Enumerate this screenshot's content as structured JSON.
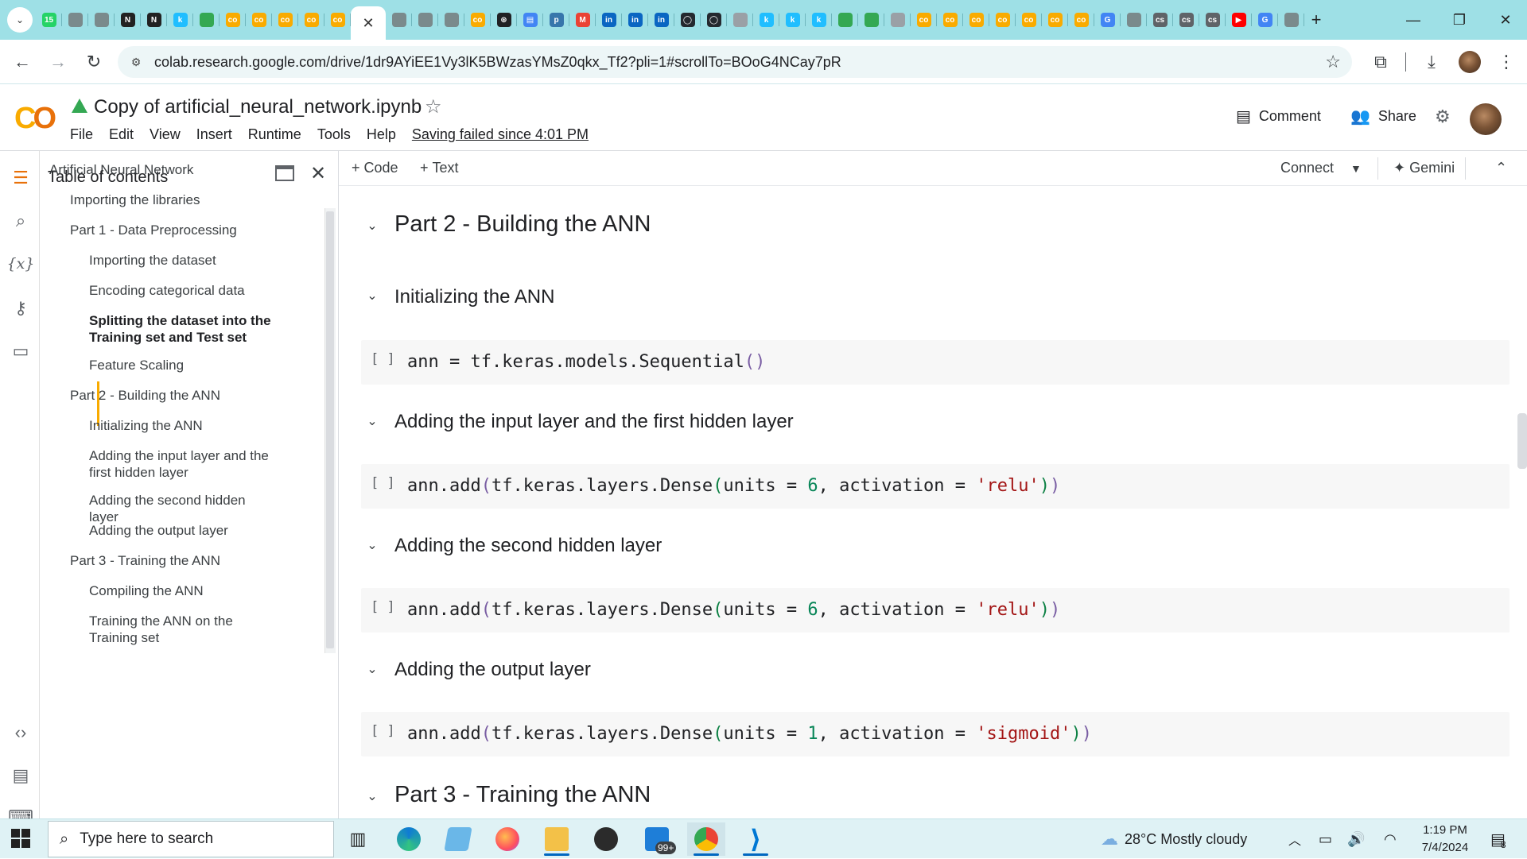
{
  "browser": {
    "tab_favicons": [
      {
        "name": "whatsapp-tab",
        "color": "#25d366",
        "label": "15"
      },
      {
        "name": "globe-tab",
        "color": "#7a8a8c",
        "label": ""
      },
      {
        "name": "globe-tab",
        "color": "#7a8a8c",
        "label": ""
      },
      {
        "name": "notion-tab",
        "color": "#222222",
        "label": "N"
      },
      {
        "name": "notion-tab",
        "color": "#222222",
        "label": "N"
      },
      {
        "name": "kaggle-tab",
        "color": "#20beff",
        "label": "k"
      },
      {
        "name": "drive-tab",
        "color": "#34a853",
        "label": ""
      },
      {
        "name": "colab-tab",
        "color": "#f9ab00",
        "label": "co"
      },
      {
        "name": "colab-tab",
        "color": "#f9ab00",
        "label": "co"
      },
      {
        "name": "colab-tab",
        "color": "#f9ab00",
        "label": "co"
      },
      {
        "name": "colab-tab",
        "color": "#f9ab00",
        "label": "co"
      },
      {
        "name": "colab-tab",
        "color": "#f9ab00",
        "label": "co"
      }
    ],
    "active_tab_close": "✕",
    "tab_favicons_after": [
      {
        "name": "globe-tab",
        "color": "#7a8a8c",
        "label": ""
      },
      {
        "name": "globe-tab",
        "color": "#7a8a8c",
        "label": ""
      },
      {
        "name": "globe-tab",
        "color": "#7a8a8c",
        "label": ""
      },
      {
        "name": "colab-tab",
        "color": "#f9ab00",
        "label": "co"
      },
      {
        "name": "chatgpt-tab",
        "color": "#202124",
        "label": "⊛"
      },
      {
        "name": "docs-tab",
        "color": "#4285f4",
        "label": "▤"
      },
      {
        "name": "python-tab",
        "color": "#3776ab",
        "label": "p"
      },
      {
        "name": "gmail-tab",
        "color": "#ea4335",
        "label": "M"
      },
      {
        "name": "linkedin-tab",
        "color": "#0a66c2",
        "label": "in"
      },
      {
        "name": "linkedin-tab",
        "color": "#0a66c2",
        "label": "in"
      },
      {
        "name": "linkedin-tab",
        "color": "#0a66c2",
        "label": "in"
      },
      {
        "name": "github-tab",
        "color": "#24292f",
        "label": "◯"
      },
      {
        "name": "github-tab",
        "color": "#24292f",
        "label": "◯"
      },
      {
        "name": "globe-tab",
        "color": "#9aa0a6",
        "label": ""
      },
      {
        "name": "kaggle-tab",
        "color": "#20beff",
        "label": "k"
      },
      {
        "name": "kaggle-tab",
        "color": "#20beff",
        "label": "k"
      },
      {
        "name": "kaggle-tab",
        "color": "#20beff",
        "label": "k"
      },
      {
        "name": "drive-tab",
        "color": "#34a853",
        "label": ""
      },
      {
        "name": "drive-tab",
        "color": "#34a853",
        "label": ""
      },
      {
        "name": "drive-tab",
        "color": "#9aa0a6",
        "label": ""
      },
      {
        "name": "colab-tab",
        "color": "#f9ab00",
        "label": "co"
      },
      {
        "name": "colab-tab",
        "color": "#f9ab00",
        "label": "co"
      },
      {
        "name": "colab-tab",
        "color": "#f9ab00",
        "label": "co"
      },
      {
        "name": "colab-tab",
        "color": "#f9ab00",
        "label": "co"
      },
      {
        "name": "colab-tab",
        "color": "#f9ab00",
        "label": "co"
      },
      {
        "name": "colab-tab",
        "color": "#f9ab00",
        "label": "co"
      },
      {
        "name": "colab-tab",
        "color": "#f9ab00",
        "label": "co"
      },
      {
        "name": "google-tab",
        "color": "#4285f4",
        "label": "G"
      },
      {
        "name": "globe-tab",
        "color": "#7a8a8c",
        "label": ""
      },
      {
        "name": "cisco-tab",
        "color": "#5f6368",
        "label": "cs"
      },
      {
        "name": "cisco-tab",
        "color": "#5f6368",
        "label": "cs"
      },
      {
        "name": "cisco-tab",
        "color": "#5f6368",
        "label": "cs"
      },
      {
        "name": "youtube-tab",
        "color": "#ff0000",
        "label": "▶"
      },
      {
        "name": "google-tab",
        "color": "#4285f4",
        "label": "G"
      },
      {
        "name": "globe-tab",
        "color": "#7a8a8c",
        "label": ""
      }
    ],
    "new_tab": "+",
    "url": "colab.research.google.com/drive/1dr9AYiEE1Vy3lK5BWzasYMsZ0qkx_Tf2?pli=1#scrollTo=BOoG4NCay7pR"
  },
  "colab": {
    "notebook_title": "Copy of artificial_neural_network.ipynb",
    "menu": [
      "File",
      "Edit",
      "View",
      "Insert",
      "Runtime",
      "Tools",
      "Help"
    ],
    "save_status": "Saving failed since 4:01 PM",
    "comment_label": "Comment",
    "share_label": "Share",
    "toolbar": {
      "code": "Code",
      "text": "Text",
      "connect": "Connect",
      "gemini": "Gemini"
    }
  },
  "toc": {
    "title": "Table of contents",
    "items": [
      {
        "label": "Artificial Neural Network",
        "level": 0
      },
      {
        "label": "Importing the libraries",
        "level": 1
      },
      {
        "label": "Part 1 - Data Preprocessing",
        "level": 1
      },
      {
        "label": "Importing the dataset",
        "level": 2
      },
      {
        "label": "Encoding categorical data",
        "level": 2
      },
      {
        "label": "Splitting the dataset into the Training set and Test set",
        "level": 2,
        "active": true
      },
      {
        "label": "Feature Scaling",
        "level": 2
      },
      {
        "label": "Part 2 - Building the ANN",
        "level": 1
      },
      {
        "label": "Initializing the ANN",
        "level": 2
      },
      {
        "label": "Adding the input layer and the first hidden layer",
        "level": 2
      },
      {
        "label": "Adding the second hidden layer",
        "level": 2
      },
      {
        "label": "Adding the output layer",
        "level": 2
      },
      {
        "label": "Part 3 - Training the ANN",
        "level": 1
      },
      {
        "label": "Compiling the ANN",
        "level": 2
      },
      {
        "label": "Training the ANN on the Training set",
        "level": 2
      }
    ]
  },
  "notebook": {
    "headings": {
      "part2": "Part 2 - Building the ANN",
      "init": "Initializing the ANN",
      "input_layer": "Adding the input layer and the first hidden layer",
      "second_layer": "Adding the second hidden layer",
      "output_layer": "Adding the output layer",
      "part3": "Part 3 - Training the ANN"
    },
    "cell_bracket": "[ ]",
    "code": {
      "init": {
        "a": "ann = tf.keras.models.Sequential",
        "p1": "(",
        "p2": ")"
      },
      "c1": {
        "a": "ann.add",
        "p1": "(",
        "b": "tf.keras.layers.Dense",
        "p2": "(",
        "c": "units = ",
        "num": "6",
        "d": ", activation = ",
        "str": "'relu'",
        "p3": ")",
        "p4": ")"
      },
      "c2": {
        "a": "ann.add",
        "p1": "(",
        "b": "tf.keras.layers.Dense",
        "p2": "(",
        "c": "units = ",
        "num": "6",
        "d": ", activation = ",
        "str": "'relu'",
        "p3": ")",
        "p4": ")"
      },
      "c3": {
        "a": "ann.add",
        "p1": "(",
        "b": "tf.keras.layers.Dense",
        "p2": "(",
        "c": "units = ",
        "num": "1",
        "d": ", activation = ",
        "str": "'sigmoid'",
        "p3": ")",
        "p4": ")"
      }
    }
  },
  "taskbar": {
    "search_placeholder": "Type here to search",
    "mail_badge": "99+",
    "weather": "28°C  Mostly cloudy",
    "time": "1:19 PM",
    "date": "7/4/2024",
    "notifications": "8"
  }
}
